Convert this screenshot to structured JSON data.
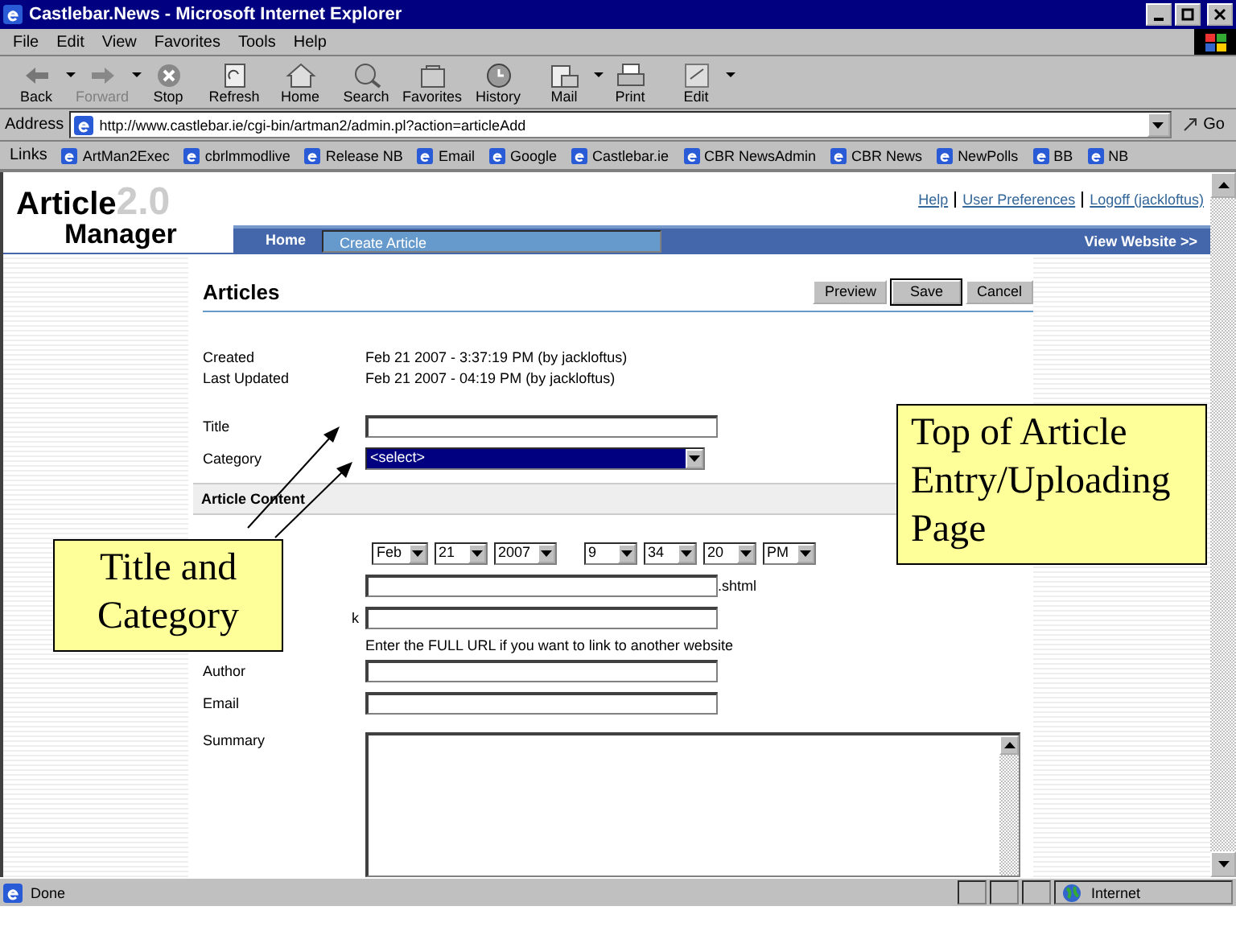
{
  "window": {
    "title": "Castlebar.News - Microsoft Internet Explorer"
  },
  "menu": [
    "File",
    "Edit",
    "View",
    "Favorites",
    "Tools",
    "Help"
  ],
  "toolbar": [
    {
      "label": "Back",
      "kind": "back",
      "disabled": false,
      "dropdown": true
    },
    {
      "label": "Forward",
      "kind": "forward",
      "disabled": true,
      "dropdown": true
    },
    {
      "label": "Stop",
      "kind": "stop",
      "disabled": false,
      "dropdown": false
    },
    {
      "label": "Refresh",
      "kind": "refresh",
      "disabled": false,
      "dropdown": false
    },
    {
      "label": "Home",
      "kind": "home",
      "disabled": false,
      "dropdown": false
    },
    {
      "label": "Search",
      "kind": "search",
      "disabled": false,
      "dropdown": false
    },
    {
      "label": "Favorites",
      "kind": "favorites",
      "disabled": false,
      "dropdown": false
    },
    {
      "label": "History",
      "kind": "history",
      "disabled": false,
      "dropdown": false
    },
    {
      "label": "Mail",
      "kind": "mail",
      "disabled": false,
      "dropdown": true
    },
    {
      "label": "Print",
      "kind": "print",
      "disabled": false,
      "dropdown": false
    },
    {
      "label": "Edit",
      "kind": "edit",
      "disabled": false,
      "dropdown": true
    }
  ],
  "address": {
    "label": "Address",
    "value": "http://www.castlebar.ie/cgi-bin/artman2/admin.pl?action=articleAdd",
    "go": "Go"
  },
  "links": {
    "label": "Links",
    "items": [
      "ArtMan2Exec",
      "cbrlmmodlive",
      "Release NB",
      "Email",
      "Google",
      "Castlebar.ie",
      "CBR NewsAdmin",
      "CBR News",
      "NewPolls",
      "BB",
      "NB"
    ]
  },
  "page": {
    "logo": {
      "word1": "Article",
      "version": "2.0",
      "word2": "Manager"
    },
    "top_links": [
      "Help",
      "User Preferences",
      "Logoff (jackloftus)"
    ],
    "nav_tabs": [
      {
        "label": "Home",
        "selected": false
      },
      {
        "label": "Create Article",
        "selected": true
      }
    ],
    "view_website": "View Website >>",
    "heading": "Articles",
    "buttons": [
      {
        "label": "Preview",
        "default": false
      },
      {
        "label": "Save",
        "default": true
      },
      {
        "label": "Cancel",
        "default": false
      }
    ],
    "info": [
      {
        "label": "Created",
        "value": "Feb 21 2007 - 3:37:19 PM (by jackloftus)"
      },
      {
        "label": "Last Updated",
        "value": "Feb 21 2007 - 04:19 PM (by jackloftus)"
      }
    ],
    "title_field": {
      "label": "Title"
    },
    "category": {
      "label": "Category",
      "value": "<select>"
    },
    "section": "Article Content",
    "date_selects": [
      "Feb",
      "21",
      "2007",
      "9",
      "34",
      "20",
      "PM"
    ],
    "filename_suffix": ".shtml",
    "link_label_tail": "k",
    "link_hint": "Enter the FULL URL if you want to link to another website",
    "author": {
      "label": "Author"
    },
    "email": {
      "label": "Email"
    },
    "summary": {
      "label": "Summary"
    }
  },
  "status_bar": {
    "text": "Done",
    "zone": "Internet"
  },
  "callouts": [
    {
      "text": "Top of Article Entry/Uploading Page",
      "kind": "page"
    },
    {
      "text": "Title and Category",
      "kind": "fields"
    }
  ]
}
